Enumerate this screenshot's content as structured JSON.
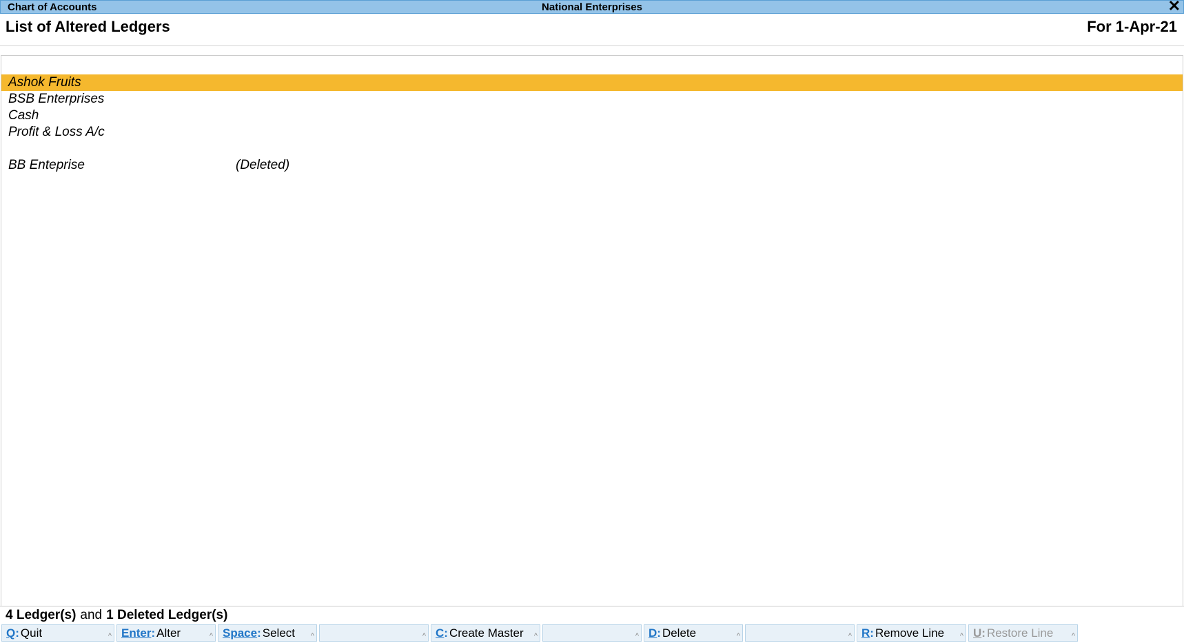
{
  "titleBar": {
    "left": "Chart of Accounts",
    "center": "National Enterprises"
  },
  "subtitle": {
    "left": "List of Altered Ledgers",
    "right": "For 1-Apr-21"
  },
  "ledgers": [
    {
      "name": "Ashok Fruits",
      "selected": true,
      "status": ""
    },
    {
      "name": "BSB Enterprises",
      "selected": false,
      "status": ""
    },
    {
      "name": "Cash",
      "selected": false,
      "status": ""
    },
    {
      "name": "Profit & Loss A/c",
      "selected": false,
      "status": ""
    }
  ],
  "deletedLedgers": [
    {
      "name": "BB Enteprise",
      "status": "(Deleted)"
    }
  ],
  "summary": {
    "ledgerCount": "4 Ledger(s)",
    "connector": "and",
    "deletedCount": "1 Deleted Ledger(s)"
  },
  "buttons": {
    "quit": {
      "key": "Q",
      "label": "Quit"
    },
    "alter": {
      "key": "Enter",
      "label": "Alter"
    },
    "select": {
      "key": "Space",
      "label": "Select"
    },
    "create": {
      "key": "C",
      "label": "Create Master"
    },
    "delete": {
      "key": "D",
      "label": "Delete"
    },
    "remove": {
      "key": "R",
      "label": "Remove Line"
    },
    "restore": {
      "key": "U",
      "label": "Restore Line"
    }
  }
}
